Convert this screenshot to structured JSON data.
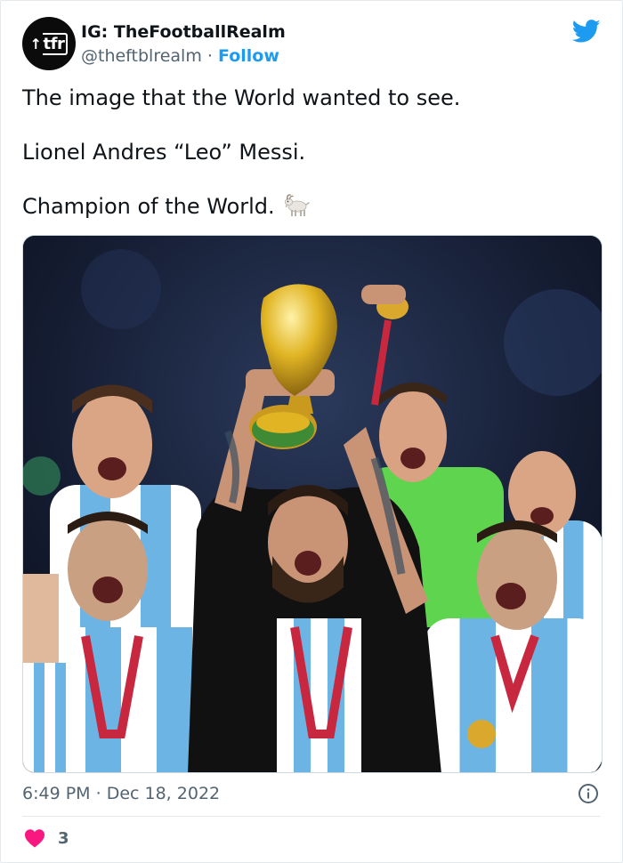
{
  "author": {
    "display_name": "IG: TheFootballRealm",
    "handle": "@theftblrealm",
    "separator": "·",
    "follow_label": "Follow",
    "avatar_text": "tfr"
  },
  "tweet": {
    "lines": [
      "The image that the World wanted to see.",
      "Lionel Andres “Leo” Messi.",
      "Champion of the World."
    ],
    "emoji": "goat-emoji"
  },
  "media": {
    "kind": "photo",
    "subject": "photo"
  },
  "meta": {
    "time": "6:49 PM",
    "separator": "·",
    "date": "Dec 18, 2022"
  },
  "engagement": {
    "likes": "3"
  },
  "colors": {
    "twitter_blue": "#1d9bf0",
    "heart_red": "#f91880",
    "secondary_text": "#536471"
  },
  "icons": {
    "brand": "twitter-bird-icon",
    "info": "info-icon",
    "like": "heart-icon"
  }
}
